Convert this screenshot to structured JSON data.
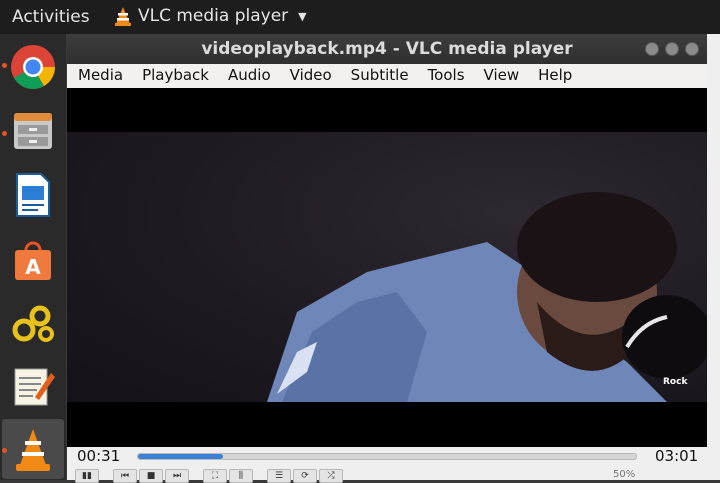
{
  "topbar": {
    "activities": "Activities",
    "app_name": "VLC media player"
  },
  "dock": {
    "items": [
      {
        "name": "chrome-icon",
        "running": true
      },
      {
        "name": "files-icon",
        "running": true
      },
      {
        "name": "writer-icon",
        "running": false
      },
      {
        "name": "software-center-icon",
        "running": false
      },
      {
        "name": "settings-gears-icon",
        "running": false
      },
      {
        "name": "text-editor-icon",
        "running": false
      },
      {
        "name": "vlc-icon",
        "running": true,
        "active": true
      }
    ]
  },
  "window": {
    "title": "videoplayback.mp4 - VLC media player",
    "menu": [
      "Media",
      "Playback",
      "Audio",
      "Video",
      "Subtitle",
      "Tools",
      "View",
      "Help"
    ],
    "watermark": "Rock"
  },
  "controls": {
    "elapsed": "00:31",
    "total": "03:01",
    "progress": 0.17,
    "volume": "50%"
  },
  "colors": {
    "accent": "#e95420",
    "seek": "#3a82d6"
  }
}
